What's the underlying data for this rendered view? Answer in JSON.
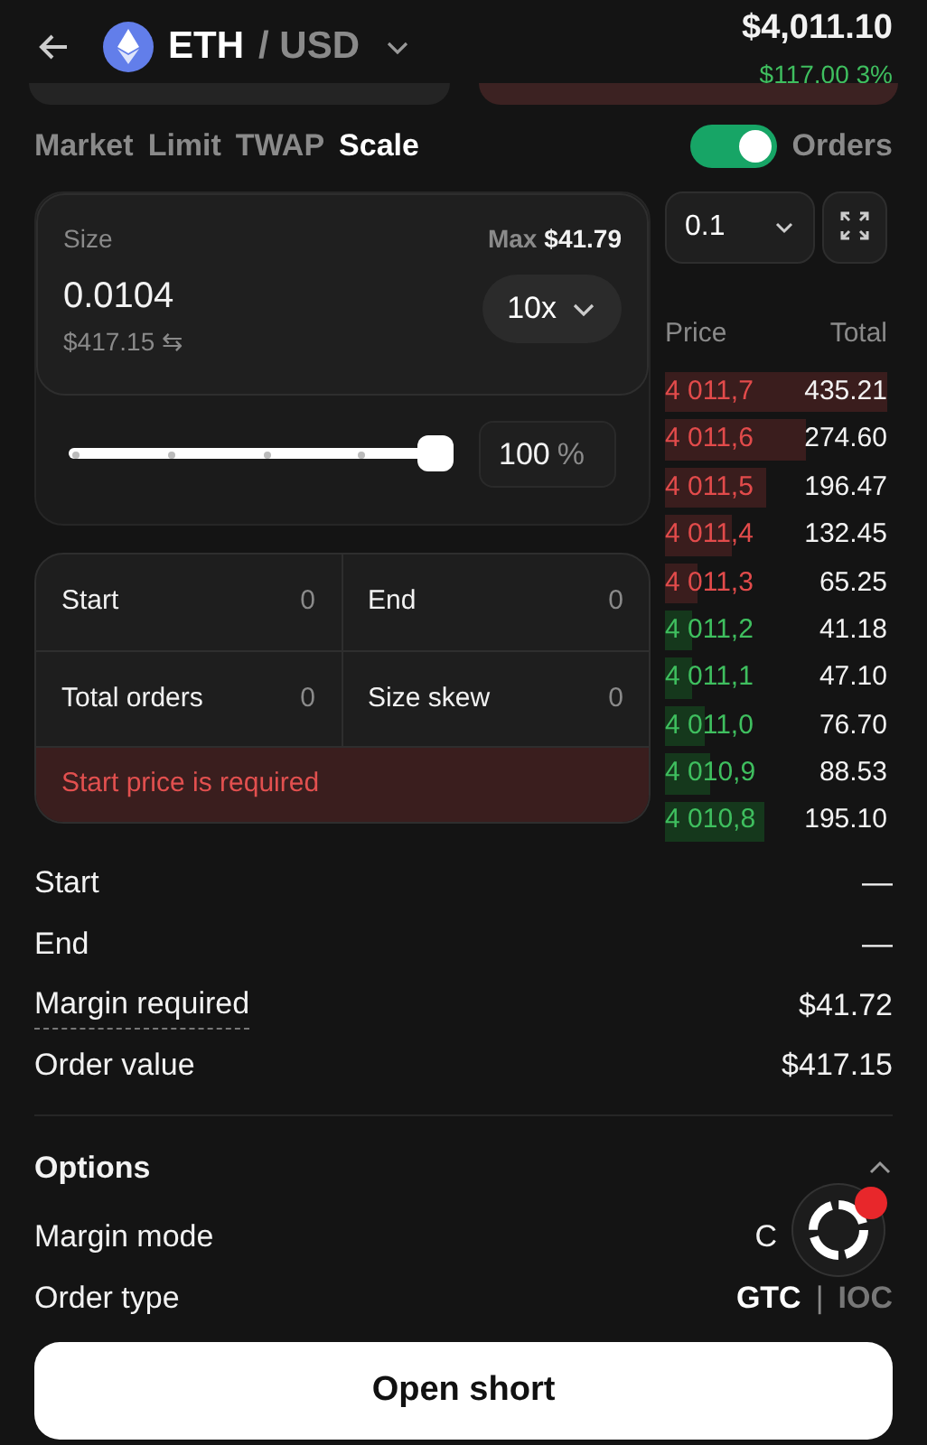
{
  "header": {
    "base": "ETH",
    "quote": "/ USD",
    "price": "$4,011.10",
    "change": "$117.00 3%"
  },
  "top_buttons": [
    {
      "kind": "neutral"
    },
    {
      "kind": "danger"
    }
  ],
  "tabs": [
    {
      "label": "Market",
      "selected": false
    },
    {
      "label": "Limit",
      "selected": false
    },
    {
      "label": "TWAP",
      "selected": false
    },
    {
      "label": "Scale",
      "selected": true
    }
  ],
  "orders_toggle": {
    "label": "Orders",
    "on": true
  },
  "size": {
    "label": "Size",
    "max_label": "Max",
    "max_value": "$41.79",
    "value": "0.0104",
    "usd": "$417.15",
    "swap": "⇆",
    "leverage": "10x"
  },
  "slider": {
    "level": 1,
    "percent": "100",
    "unit": "%"
  },
  "scale_fields": [
    {
      "label": "Start",
      "placeholder": "0"
    },
    {
      "label": "End",
      "placeholder": "0"
    },
    {
      "label": "Total orders",
      "placeholder": "0"
    },
    {
      "label": "Size skew",
      "placeholder": "0"
    }
  ],
  "error": "Start price is required",
  "book": {
    "tick": "0.1",
    "columns": [
      "Price",
      "Total"
    ],
    "rows": [
      {
        "price": "4 011,7",
        "total": "435.21",
        "kind": "ask"
      },
      {
        "price": "4 011,6",
        "total": "274.60",
        "kind": "ask"
      },
      {
        "price": "4 011,5",
        "total": "196.47",
        "kind": "ask"
      },
      {
        "price": "4 011,4",
        "total": "132.45",
        "kind": "ask"
      },
      {
        "price": "4 011,3",
        "total": "65.25",
        "kind": "ask"
      },
      {
        "price": "4 011,2",
        "total": "41.18",
        "kind": "bid"
      },
      {
        "price": "4 011,1",
        "total": "47.10",
        "kind": "bid"
      },
      {
        "price": "4 011,0",
        "total": "76.70",
        "kind": "bid"
      },
      {
        "price": "4 010,9",
        "total": "88.53",
        "kind": "bid"
      },
      {
        "price": "4 010,8",
        "total": "195.10",
        "kind": "bid"
      }
    ]
  },
  "summary": [
    {
      "label": "Start",
      "value": "—",
      "dashed": false
    },
    {
      "label": "End",
      "value": "—",
      "dashed": false
    },
    {
      "label": "Margin required",
      "value": "$41.72",
      "dashed": true
    },
    {
      "label": "Order value",
      "value": "$417.15",
      "dashed": false
    }
  ],
  "options": {
    "title": "Options",
    "expanded": true,
    "margin_mode": {
      "label": "Margin mode",
      "value": "C"
    },
    "order_type": {
      "label": "Order type",
      "choices": [
        {
          "label": "GTC",
          "selected": true
        },
        {
          "label": "IOC",
          "selected": false
        }
      ],
      "separator": "|"
    }
  },
  "float_button": {
    "badge": true
  },
  "submit": "Open short"
}
